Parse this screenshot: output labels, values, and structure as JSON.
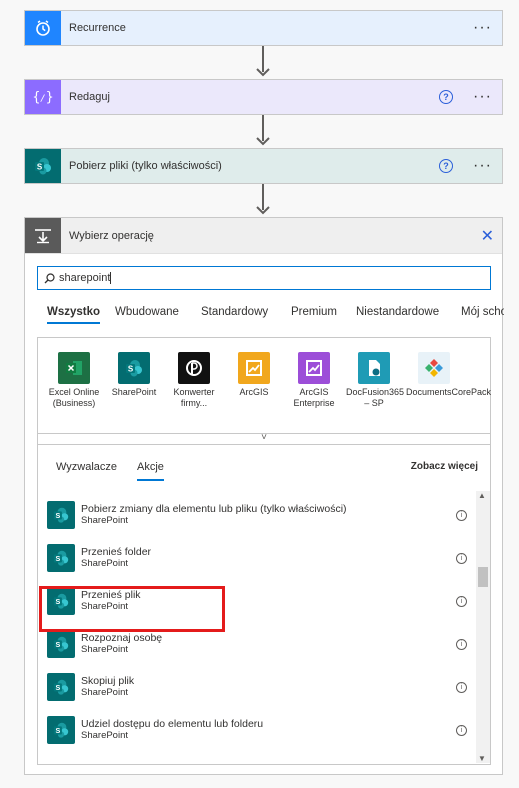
{
  "steps": [
    {
      "title": "Recurrence",
      "icon": "clock-icon",
      "help": false
    },
    {
      "title": "Redaguj",
      "icon": "braces-icon",
      "help": true
    },
    {
      "title": "Pobierz pliki (tylko właściwości)",
      "icon": "sharepoint-icon",
      "help": true
    }
  ],
  "more_label": "···",
  "help_label": "?",
  "chooser": {
    "title": "Wybierz operację",
    "close_label": "✕",
    "search_value": "sharepoint",
    "tabs": [
      "Wszystko",
      "Wbudowane",
      "Standardowy",
      "Premium",
      "Niestandardowe",
      "Mój schowe"
    ],
    "active_tab": "Wszystko",
    "connectors": [
      {
        "label": "Excel Online (Business)",
        "color": "#1d7044"
      },
      {
        "label": "SharePoint",
        "color": "#036c70"
      },
      {
        "label": "Konwerter firmy...",
        "color": "#111111"
      },
      {
        "label": "ArcGIS",
        "color": "#f1a71d"
      },
      {
        "label": "ArcGIS Enterprise",
        "color": "#9c4ed8"
      },
      {
        "label": "DocFusion365 – SP",
        "color": "#1f9bb5"
      },
      {
        "label": "DocumentsCorePack",
        "color": "#e8f2f8"
      }
    ],
    "collapse_label": "˅",
    "subtabs": [
      "Wyzwalacze",
      "Akcje"
    ],
    "active_subtab": "Akcje",
    "see_more": "Zobacz więcej",
    "actions": [
      {
        "name": "Pobierz zmiany dla elementu lub pliku (tylko właściwości)",
        "connector": "SharePoint"
      },
      {
        "name": "Przenieś folder",
        "connector": "SharePoint"
      },
      {
        "name": "Przenieś plik",
        "connector": "SharePoint"
      },
      {
        "name": "Rozpoznaj osobę",
        "connector": "SharePoint"
      },
      {
        "name": "Skopiuj plik",
        "connector": "SharePoint"
      },
      {
        "name": "Udziel dostępu do elementu lub folderu",
        "connector": "SharePoint"
      }
    ],
    "info_label": "i",
    "highlighted_action": "Przenieś plik",
    "scrollbar": {
      "position": 0.28,
      "visible_fraction": 0.08
    }
  }
}
